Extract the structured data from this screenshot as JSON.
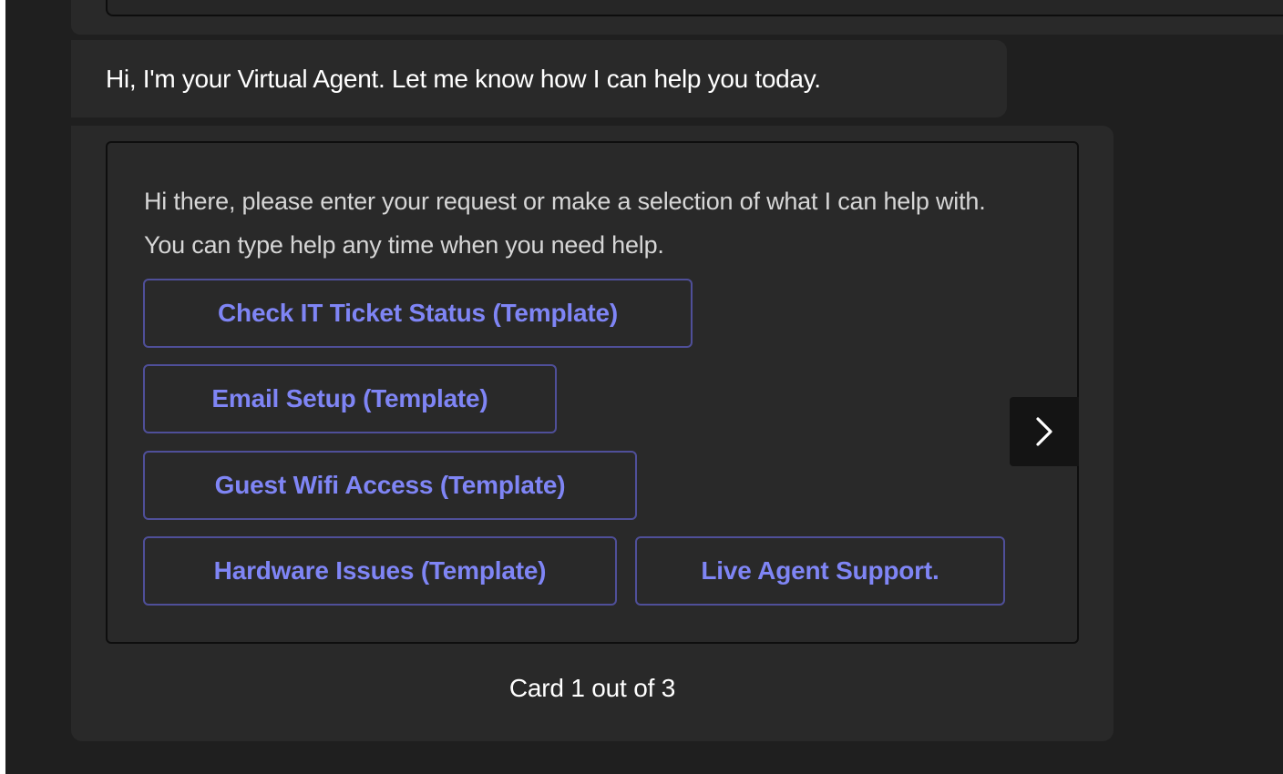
{
  "chat": {
    "greeting": "Hi, I'm your Virtual Agent. Let me know how I can help you today."
  },
  "card": {
    "prompt": "Hi there, please enter your request or make a selection of what I can help with. You can type help any time when you need help.",
    "choices": [
      {
        "label": "Check IT Ticket Status (Template)"
      },
      {
        "label": "Email Setup (Template)"
      },
      {
        "label": "Guest Wifi Access (Template)"
      },
      {
        "label": "Hardware Issues (Template)"
      },
      {
        "label": "Live Agent Support."
      }
    ]
  },
  "carousel": {
    "pager": "Card 1 out of 3",
    "next_icon": "chevron-right-icon"
  },
  "colors": {
    "background": "#1f1f1f",
    "bubble": "#292929",
    "accent": "#7f85f5",
    "button_border": "#4f4f99",
    "text": "#ffffff",
    "text_secondary": "#d6d6d6"
  }
}
